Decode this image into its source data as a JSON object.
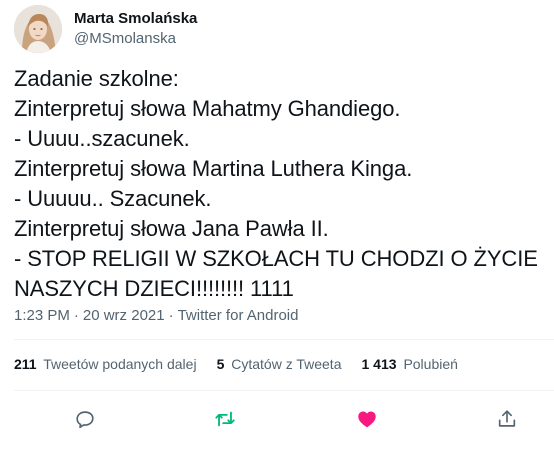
{
  "author": {
    "display_name": "Marta Smolańska",
    "handle": "@MSmolanska"
  },
  "tweet": {
    "lines": [
      "Zadanie szkolne:",
      "Zinterpretuj słowa Mahatmy Ghandiego.",
      "- Uuuu..szacunek.",
      "Zinterpretuj słowa Martina Luthera Kinga.",
      "- Uuuuu.. Szacunek.",
      "Zinterpretuj słowa Jana Pawła II.",
      "- STOP RELIGII W SZKOŁACH TU CHODZI O ŻYCIE",
      "NASZYCH DZIECI!!!!!!!! 1111"
    ]
  },
  "meta": {
    "time": "1:23 PM",
    "separator": "·",
    "date": "20 wrz 2021",
    "source": "Twitter for Android"
  },
  "stats": {
    "retweets_count": "211",
    "retweets_label": "Tweetów podanych dalej",
    "quotes_count": "5",
    "quotes_label": "Cytatów z Tweeta",
    "likes_count": "1 413",
    "likes_label": "Polubień"
  },
  "actions": {
    "reply_icon": "reply-icon",
    "retweet_icon": "retweet-icon",
    "like_icon": "heart-icon",
    "share_icon": "share-icon"
  },
  "colors": {
    "text": "#0f1419",
    "secondary": "#536471",
    "divider": "#eff3f4",
    "retweet_active": "#00ba7c",
    "like_active": "#f91880"
  }
}
